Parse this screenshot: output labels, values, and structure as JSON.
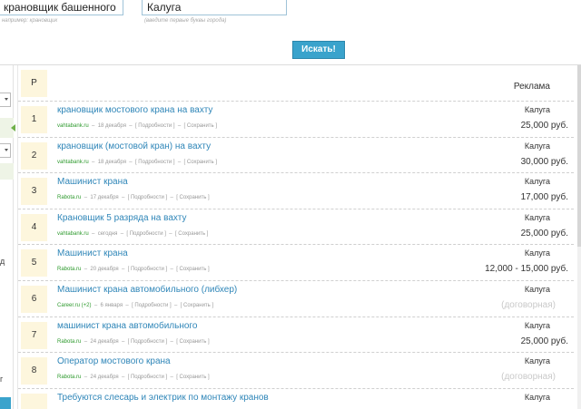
{
  "search": {
    "query_value": "крановщик башенного крана",
    "query_hint": "например: крановщик",
    "location_value": "Калуга",
    "location_hint": "(введите первые буквы города)",
    "button_label": "Искать!"
  },
  "sidebar": {
    "text_1": "д",
    "text_2": "г"
  },
  "table": {
    "num_header": "Р",
    "ad_header": "Реклама",
    "rows": [
      {
        "num": "1",
        "title": "крановщик мостового крана на вахту",
        "source": "vahtabank.ru",
        "date": "18 декабря",
        "details": "[ Подробности ]",
        "save": "[ Сохранить ]",
        "city": "Калуга",
        "salary": "25,000 руб."
      },
      {
        "num": "2",
        "title": "крановщик (мостовой кран) на вахту",
        "source": "vahtabank.ru",
        "date": "18 декабря",
        "details": "[ Подробности ]",
        "save": "[ Сохранить ]",
        "city": "Калуга",
        "salary": "30,000 руб."
      },
      {
        "num": "3",
        "title": "Машинист крана",
        "source": "Rabota.ru",
        "date": "17 декабря",
        "details": "[ Подробности ]",
        "save": "[ Сохранить ]",
        "city": "Калуга",
        "salary": "17,000 руб."
      },
      {
        "num": "4",
        "title": "Крановщик 5 разряда на вахту",
        "source": "vahtabank.ru",
        "date": "сегодня",
        "details": "[ Подробности ]",
        "save": "[ Сохранить ]",
        "city": "Калуга",
        "salary": "25,000 руб."
      },
      {
        "num": "5",
        "title": "Машинист крана",
        "source": "Rabota.ru",
        "date": "20 декабря",
        "details": "[ Подробности ]",
        "save": "[ Сохранить ]",
        "city": "Калуга",
        "salary": "12,000 - 15,000 руб."
      },
      {
        "num": "6",
        "title": "Машинист крана автомобильного (либхер)",
        "source": "Career.ru (+2)",
        "date": "6 января",
        "details": "[ Подробности ]",
        "save": "[ Сохранить ]",
        "city": "Калуга",
        "salary": "(договорная)"
      },
      {
        "num": "7",
        "title": "машинист крана автомобильного",
        "source": "Rabota.ru",
        "date": "24 декабря",
        "details": "[ Подробности ]",
        "save": "[ Сохранить ]",
        "city": "Калуга",
        "salary": "25,000 руб."
      },
      {
        "num": "8",
        "title": "Оператор мостового крана",
        "source": "Rabota.ru",
        "date": "24 декабря",
        "details": "[ Подробности ]",
        "save": "[ Сохранить ]",
        "city": "Калуга",
        "salary": "(договорная)"
      },
      {
        "num": "",
        "title": "Требуются слесарь и электрик по монтажу кранов",
        "source": "",
        "date": "",
        "details": "",
        "save": "",
        "city": "Калуга",
        "salary": ""
      }
    ]
  }
}
